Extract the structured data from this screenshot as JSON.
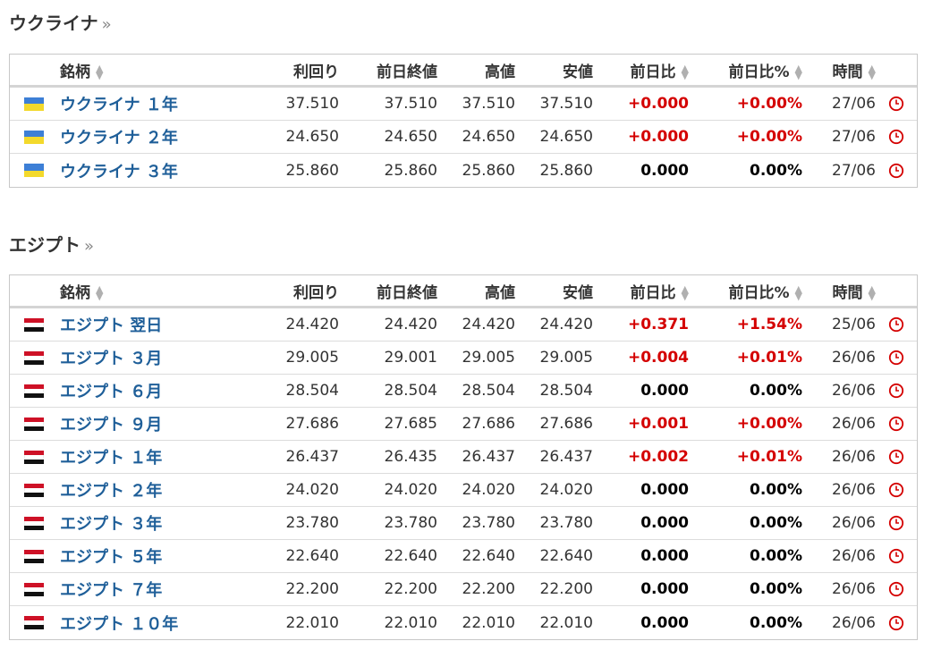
{
  "sections": [
    {
      "title": "ウクライナ",
      "more": "»",
      "headers": {
        "name": "銘柄",
        "yield": "利回り",
        "prev_close": "前日終値",
        "high": "高値",
        "low": "安値",
        "change": "前日比",
        "change_pct": "前日比%",
        "time": "時間"
      },
      "rows": [
        {
          "flag": "ukraine-flag",
          "name": "ウクライナ １年",
          "yield": "37.510",
          "prev": "37.510",
          "high": "37.510",
          "low": "37.510",
          "chg": "+0.000",
          "pct": "+0.00%",
          "time": "27/06",
          "sign": "pos"
        },
        {
          "flag": "ukraine-flag",
          "name": "ウクライナ ２年",
          "yield": "24.650",
          "prev": "24.650",
          "high": "24.650",
          "low": "24.650",
          "chg": "+0.000",
          "pct": "+0.00%",
          "time": "27/06",
          "sign": "pos"
        },
        {
          "flag": "ukraine-flag",
          "name": "ウクライナ ３年",
          "yield": "25.860",
          "prev": "25.860",
          "high": "25.860",
          "low": "25.860",
          "chg": "0.000",
          "pct": "0.00%",
          "time": "27/06",
          "sign": "zero"
        }
      ]
    },
    {
      "title": "エジプト",
      "more": "»",
      "headers": {
        "name": "銘柄",
        "yield": "利回り",
        "prev_close": "前日終値",
        "high": "高値",
        "low": "安値",
        "change": "前日比",
        "change_pct": "前日比%",
        "time": "時間"
      },
      "rows": [
        {
          "flag": "egypt-flag",
          "name": "エジプト 翌日",
          "yield": "24.420",
          "prev": "24.420",
          "high": "24.420",
          "low": "24.420",
          "chg": "+0.371",
          "pct": "+1.54%",
          "time": "25/06",
          "sign": "pos"
        },
        {
          "flag": "egypt-flag",
          "name": "エジプト ３月",
          "yield": "29.005",
          "prev": "29.001",
          "high": "29.005",
          "low": "29.005",
          "chg": "+0.004",
          "pct": "+0.01%",
          "time": "26/06",
          "sign": "pos"
        },
        {
          "flag": "egypt-flag",
          "name": "エジプト ６月",
          "yield": "28.504",
          "prev": "28.504",
          "high": "28.504",
          "low": "28.504",
          "chg": "0.000",
          "pct": "0.00%",
          "time": "26/06",
          "sign": "zero"
        },
        {
          "flag": "egypt-flag",
          "name": "エジプト ９月",
          "yield": "27.686",
          "prev": "27.685",
          "high": "27.686",
          "low": "27.686",
          "chg": "+0.001",
          "pct": "+0.00%",
          "time": "26/06",
          "sign": "pos"
        },
        {
          "flag": "egypt-flag",
          "name": "エジプト １年",
          "yield": "26.437",
          "prev": "26.435",
          "high": "26.437",
          "low": "26.437",
          "chg": "+0.002",
          "pct": "+0.01%",
          "time": "26/06",
          "sign": "pos"
        },
        {
          "flag": "egypt-flag",
          "name": "エジプト ２年",
          "yield": "24.020",
          "prev": "24.020",
          "high": "24.020",
          "low": "24.020",
          "chg": "0.000",
          "pct": "0.00%",
          "time": "26/06",
          "sign": "zero"
        },
        {
          "flag": "egypt-flag",
          "name": "エジプト ３年",
          "yield": "23.780",
          "prev": "23.780",
          "high": "23.780",
          "low": "23.780",
          "chg": "0.000",
          "pct": "0.00%",
          "time": "26/06",
          "sign": "zero"
        },
        {
          "flag": "egypt-flag",
          "name": "エジプト ５年",
          "yield": "22.640",
          "prev": "22.640",
          "high": "22.640",
          "low": "22.640",
          "chg": "0.000",
          "pct": "0.00%",
          "time": "26/06",
          "sign": "zero"
        },
        {
          "flag": "egypt-flag",
          "name": "エジプト ７年",
          "yield": "22.200",
          "prev": "22.200",
          "high": "22.200",
          "low": "22.200",
          "chg": "0.000",
          "pct": "0.00%",
          "time": "26/06",
          "sign": "zero"
        },
        {
          "flag": "egypt-flag",
          "name": "エジプト １０年",
          "yield": "22.010",
          "prev": "22.010",
          "high": "22.010",
          "low": "22.010",
          "chg": "0.000",
          "pct": "0.00%",
          "time": "26/06",
          "sign": "zero"
        }
      ]
    }
  ],
  "icons": {
    "sort": "sort-icon",
    "clock": "clock-icon"
  },
  "colors": {
    "link": "#1f5f99",
    "positive": "#d40000",
    "clock": "#d40000"
  }
}
